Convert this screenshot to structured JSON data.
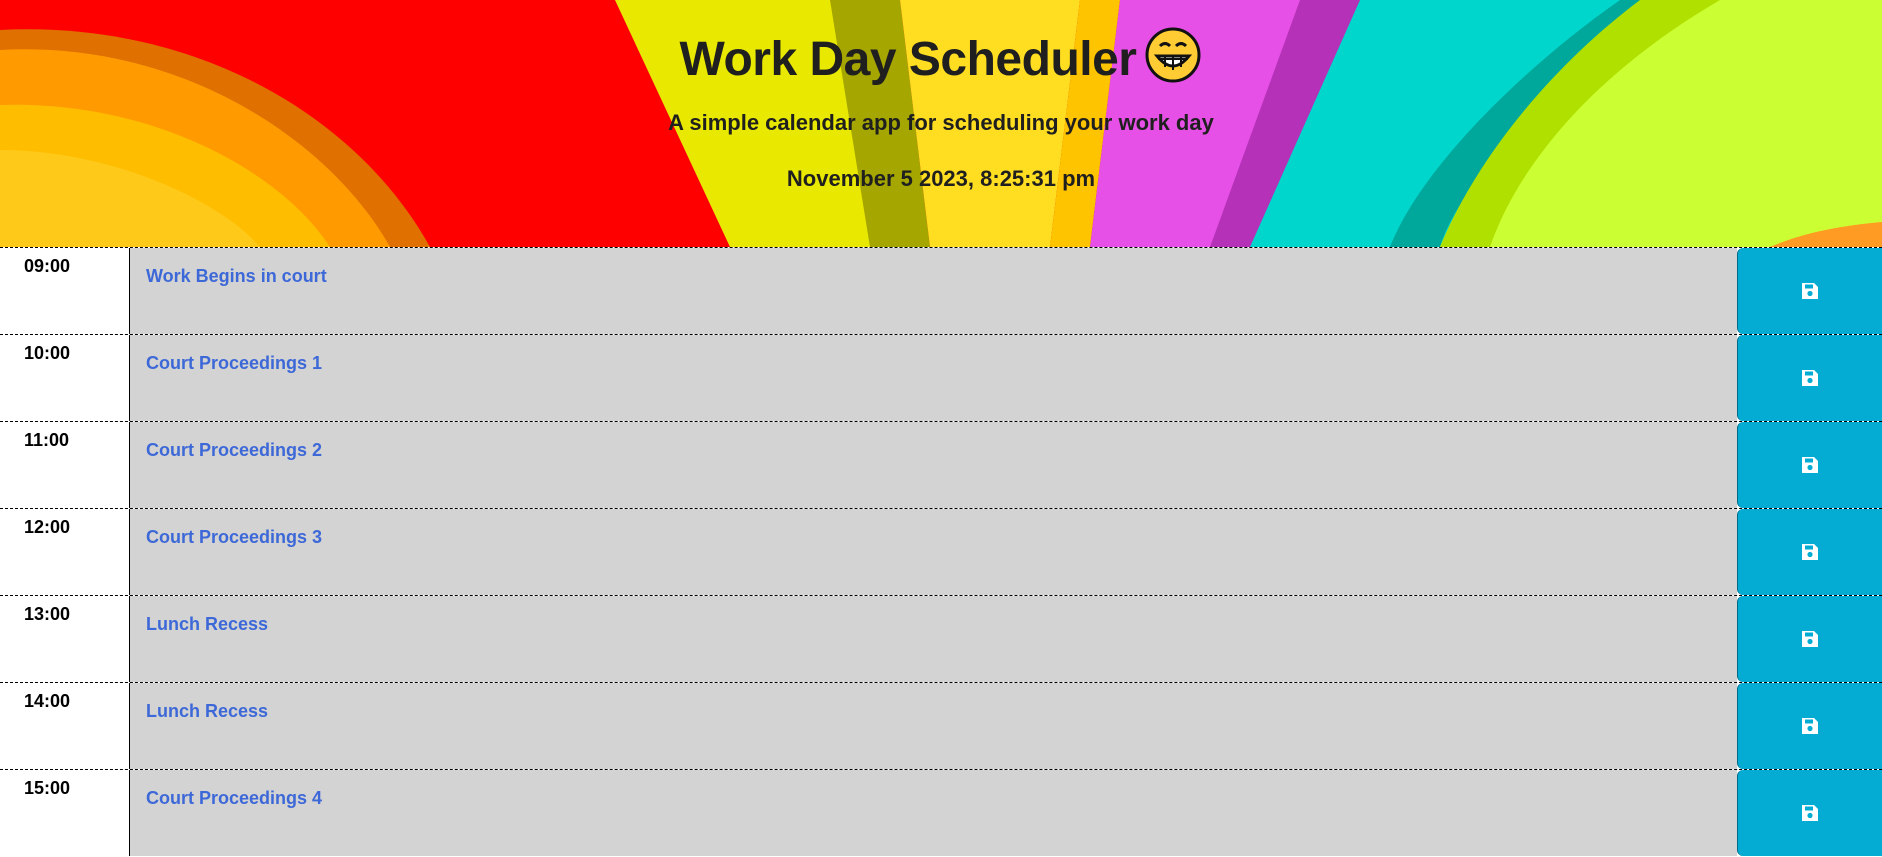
{
  "header": {
    "title": "Work Day Scheduler",
    "title_emoji": "grinning-face-emoji",
    "subtitle": "A simple calendar app for scheduling your work day",
    "datetime": "November 5 2023, 8:25:31 pm"
  },
  "colors": {
    "row_bg": "#d3d3d3",
    "event_text": "#3d68d8",
    "save_button": "#04acd4",
    "save_icon": "#ffffff"
  },
  "schedule": [
    {
      "hour": "09:00",
      "text": "Work Begins in court",
      "save_icon": "floppy-disk-icon"
    },
    {
      "hour": "10:00",
      "text": "Court Proceedings 1",
      "save_icon": "floppy-disk-icon"
    },
    {
      "hour": "11:00",
      "text": "Court Proceedings 2",
      "save_icon": "floppy-disk-icon"
    },
    {
      "hour": "12:00",
      "text": "Court Proceedings 3",
      "save_icon": "floppy-disk-icon"
    },
    {
      "hour": "13:00",
      "text": "Lunch Recess",
      "save_icon": "floppy-disk-icon"
    },
    {
      "hour": "14:00",
      "text": "Lunch Recess",
      "save_icon": "floppy-disk-icon"
    },
    {
      "hour": "15:00",
      "text": "Court Proceedings 4",
      "save_icon": "floppy-disk-icon"
    }
  ]
}
